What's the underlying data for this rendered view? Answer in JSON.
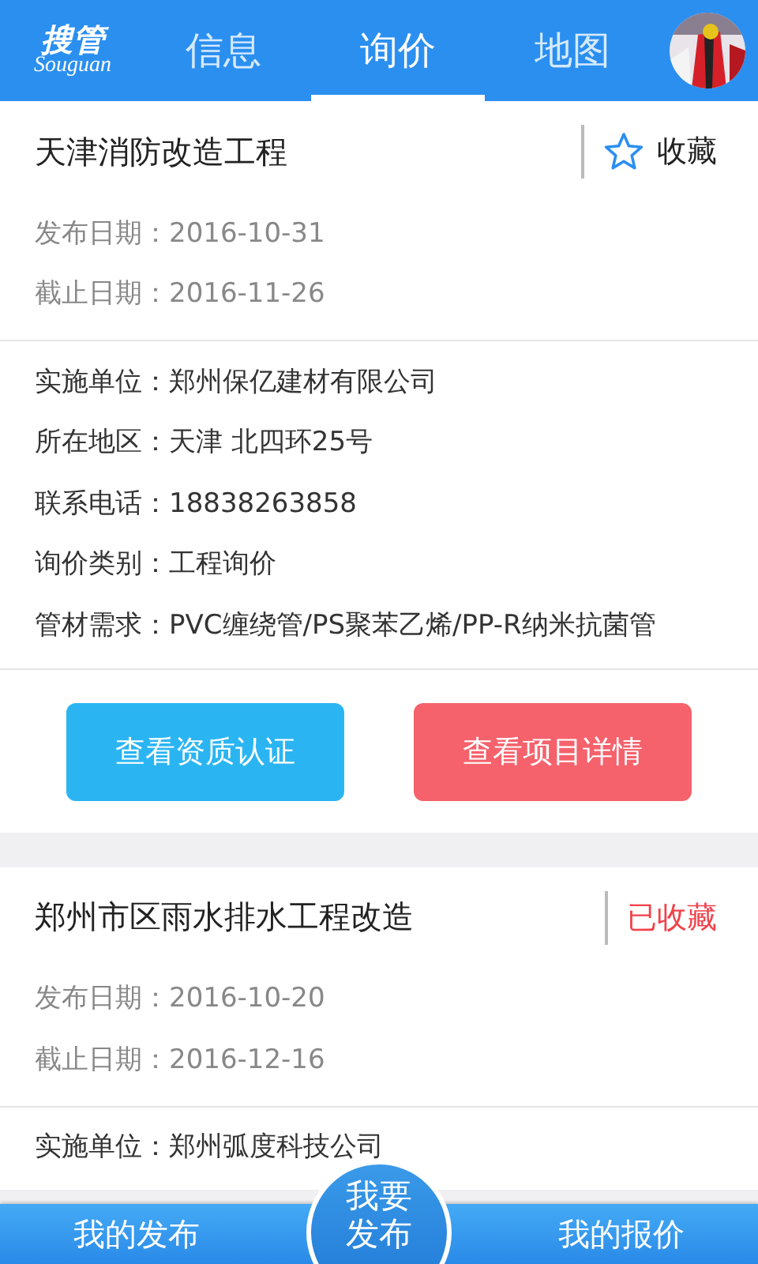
{
  "header": {
    "logo": {
      "text": "搜管",
      "subtext": "Souguan"
    },
    "tabs": [
      {
        "label": "信息",
        "selected": false
      },
      {
        "label": "询价",
        "selected": true
      },
      {
        "label": "地图",
        "selected": false
      }
    ]
  },
  "listings": [
    {
      "title": "天津消防改造工程",
      "favorited": false,
      "favorite_label": "收藏",
      "dates": [
        {
          "label": "发布日期：",
          "value": "2016-10-31"
        },
        {
          "label": "截止日期：",
          "value": "2016-11-26"
        }
      ],
      "fields": [
        {
          "label": "实施单位：",
          "value": "郑州保亿建材有限公司"
        },
        {
          "label": "所在地区：",
          "value": "天津 北四环25号"
        },
        {
          "label": "联系电话：",
          "value": "18838263858"
        },
        {
          "label": "询价类别：",
          "value": "工程询价"
        },
        {
          "label": "管材需求：",
          "value": "PVC缠绕管/PS聚苯乙烯/PP-R纳米抗菌管"
        }
      ],
      "buttons": [
        {
          "label": "查看资质认证",
          "kind": "primary"
        },
        {
          "label": "查看项目详情",
          "kind": "danger"
        }
      ]
    },
    {
      "title": "郑州市区雨水排水工程改造",
      "favorited": true,
      "favorite_label": "已收藏",
      "dates": [
        {
          "label": "发布日期：",
          "value": "2016-10-20"
        },
        {
          "label": "截止日期：",
          "value": "2016-12-16"
        }
      ],
      "fields": [
        {
          "label": "实施单位：",
          "value": "郑州弧度科技公司"
        }
      ]
    }
  ],
  "bottom_bar": {
    "left": "我的发布",
    "center": "我要发布",
    "right": "我的报价"
  }
}
